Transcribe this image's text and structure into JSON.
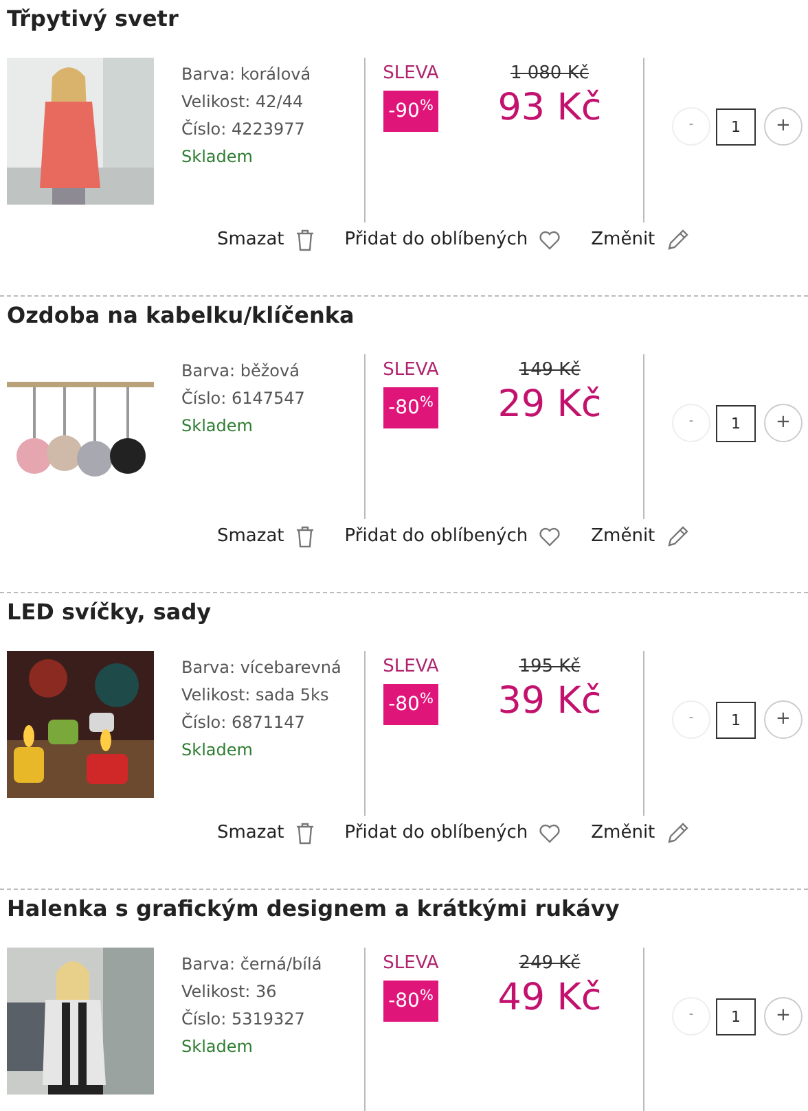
{
  "items": [
    {
      "title": "Třpytivý svetr",
      "details": [
        "Barva: korálová",
        "Velikost: 42/44",
        "Číslo: 4223977"
      ],
      "stock": "Skladem",
      "sale_label": "SLEVA",
      "discount": "-90$^{%}$",
      "old_price": "1 080 Kč",
      "price": "93 Kč",
      "decrement": "-",
      "quantity": "1",
      "decrement_disabled": true,
      "increment": "+",
      "actions": [
        {
          "kind": "delete",
          "label": "Smazat"
        },
        {
          "kind": "favorite",
          "label": "Přidat do oblíbených"
        },
        {
          "kind": "edit",
          "label": "Změnit"
        }
      ]
    },
    {
      "title": "Ozdoba na kabelku/klíčenka",
      "details": [
        "Barva: běžová",
        "Číslo: 6147547"
      ],
      "stock": "Skladem",
      "sale_label": "SLEVA",
      "discount": "-80$^{%}$",
      "old_price": "149 Kč",
      "price": "29 Kč",
      "decrement": "-",
      "quantity": "1",
      "decrement_disabled": true,
      "increment": "+",
      "actions": [
        {
          "kind": "delete",
          "label": "Smazat"
        },
        {
          "kind": "favorite",
          "label": "Přidat do oblíbených"
        },
        {
          "kind": "edit",
          "label": "Změnit"
        }
      ]
    },
    {
      "title": "LED svíčky, sady",
      "details": [
        "Barva: vícebarevná",
        "Velikost: sada 5ks",
        "Číslo: 6871147"
      ],
      "stock": "Skladem",
      "sale_label": "SLEVA",
      "discount": "-80$^{%}$",
      "old_price": "195 Kč",
      "price": "39 Kč",
      "decrement": "-",
      "quantity": "1",
      "decrement_disabled": true,
      "increment": "+",
      "actions": [
        {
          "kind": "delete",
          "label": "Smazat"
        },
        {
          "kind": "favorite",
          "label": "Přidat do oblíbených"
        },
        {
          "kind": "edit",
          "label": "Změnit"
        }
      ]
    },
    {
      "title": "Halenka s grafickým designem a krátkými rukávy",
      "details": [
        "Barva: černá/bílá",
        "Velikost: 36",
        "Číslo: 5319327"
      ],
      "stock": "Skladem",
      "sale_label": "SLEVA",
      "discount": "-80$^{%}$",
      "old_price": "249 Kč",
      "price": "49 Kč",
      "decrement": "-",
      "quantity": "1",
      "decrement_disabled": true,
      "increment": "+"
    }
  ]
}
